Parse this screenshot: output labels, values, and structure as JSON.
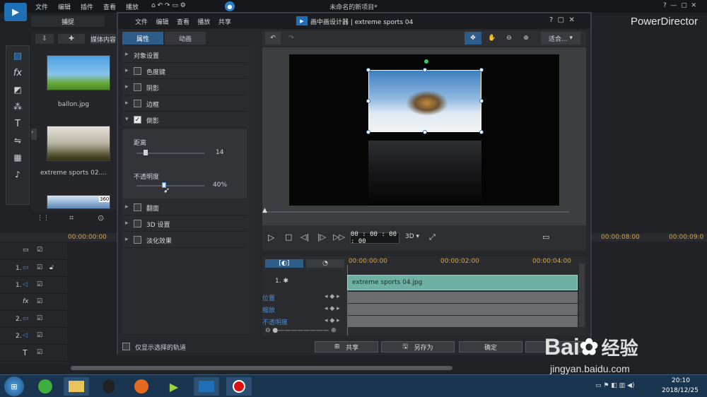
{
  "app": {
    "title": "未命名的新项目*",
    "brand": "PowerDirector",
    "menu": [
      "文件",
      "编辑",
      "插件",
      "查看",
      "播放"
    ],
    "capture_tab": "捕捉",
    "media_tab": "媒体内容"
  },
  "media": [
    {
      "name": "ballon.jpg"
    },
    {
      "name": "extreme sports 02...."
    },
    {
      "badge": "360"
    }
  ],
  "timeline": {
    "ticks": [
      "00:00:00:00",
      "00:00:08:00",
      "00:00:09:0"
    ],
    "tracks": [
      "1.",
      "1.",
      "fx",
      "2.",
      "2.",
      "T"
    ]
  },
  "dialog": {
    "title": "画中画设计器 | extreme sports 04",
    "menu": [
      "文件",
      "编辑",
      "查看",
      "播放",
      "共享"
    ],
    "tabs": [
      "属性",
      "动画"
    ],
    "props": [
      {
        "label": "对象设置",
        "checkbox": false
      },
      {
        "label": "色度键",
        "checkbox": true
      },
      {
        "label": "阴影",
        "checkbox": true
      },
      {
        "label": "边框",
        "checkbox": true
      },
      {
        "label": "倒影",
        "checkbox": true,
        "checked": true,
        "expanded": true
      }
    ],
    "reflection": {
      "distance_label": "距离",
      "distance_value": "14",
      "opacity_label": "不透明度",
      "opacity_value": "40%"
    },
    "props_after": [
      {
        "label": "翻面"
      },
      {
        "label": "3D 设置"
      },
      {
        "label": "淡化效果"
      }
    ],
    "fit": "适合...",
    "timecode": "00 : 00 : 00 : 00",
    "mode3d": "3D",
    "tl_ticks": [
      "00:00:00:00",
      "00:00:02:00",
      "00:00:04:00"
    ],
    "clip_index": "1.",
    "clip_name": "extreme sports 04.jpg",
    "param_tracks": [
      "位置",
      "缩放",
      "不透明度"
    ],
    "only_selected": "仅显示选择的轨道",
    "buttons": {
      "share": "共享",
      "save_as": "另存为",
      "ok": "确定"
    }
  },
  "taskbar": {
    "time": "20:10",
    "date": "2018/12/25"
  },
  "watermark": {
    "brand": "Bai",
    "cn": "经验",
    "url": "jingyan.baidu.com"
  }
}
